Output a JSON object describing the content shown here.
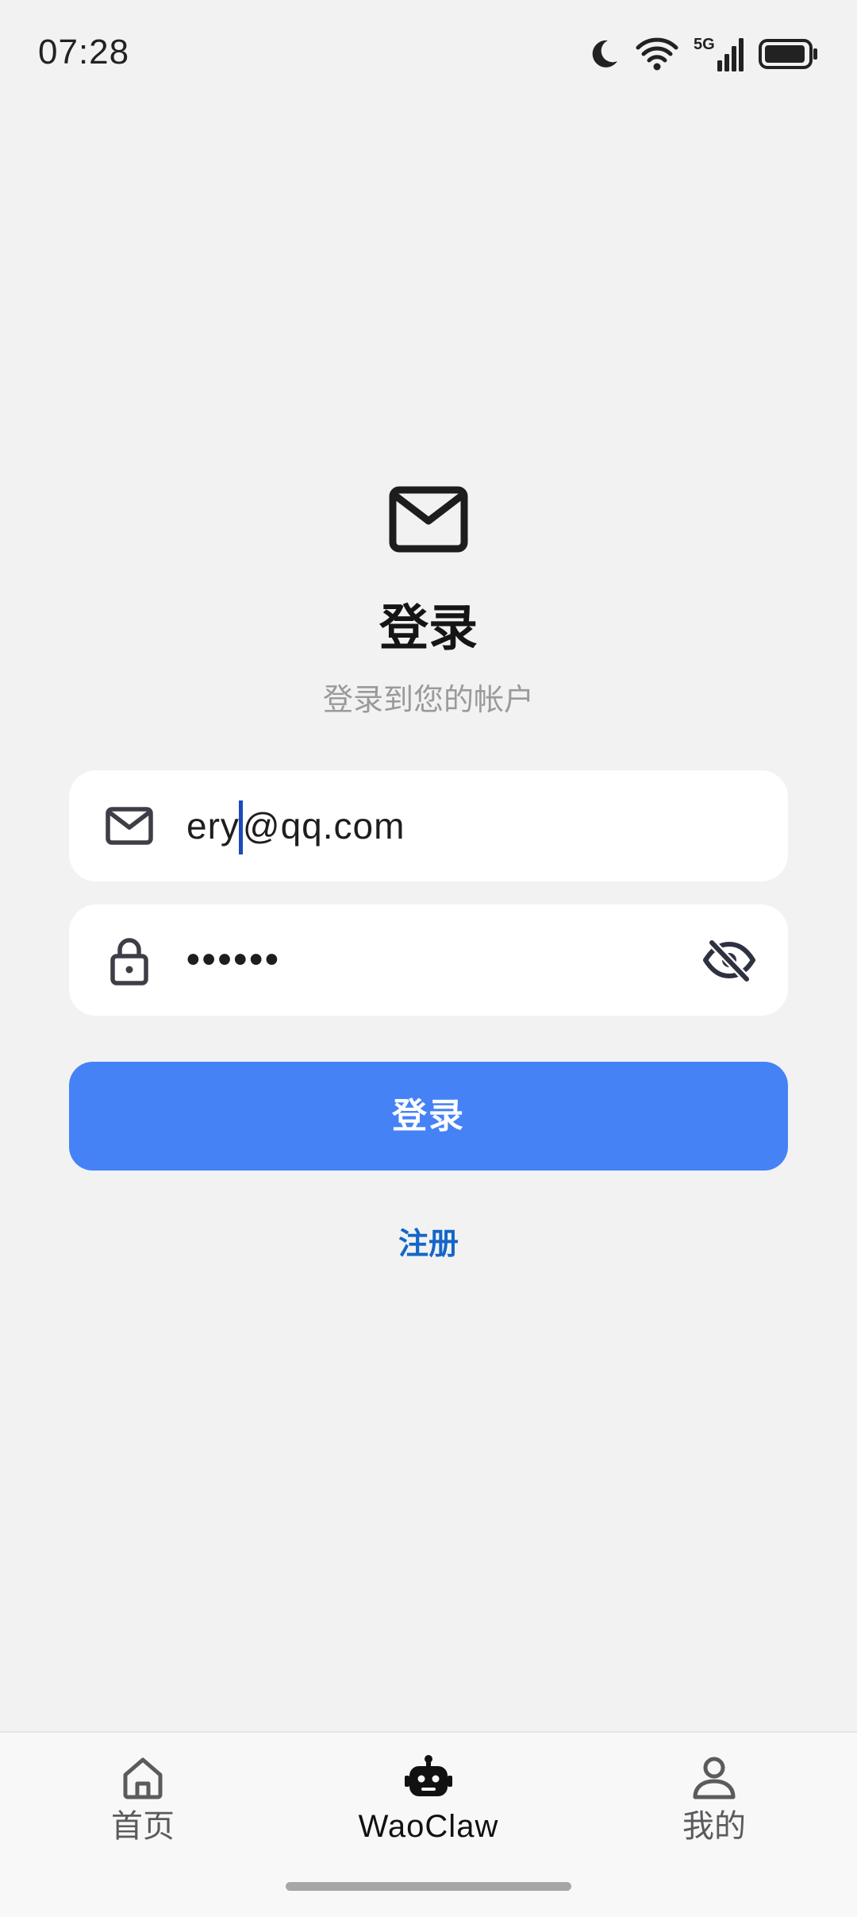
{
  "status_bar": {
    "time": "07:28",
    "network": "5G",
    "icons": [
      "moon-icon",
      "wifi-icon",
      "cellular-5g-icon",
      "battery-icon"
    ]
  },
  "login": {
    "icon": "mail-icon",
    "title": "登录",
    "subtitle": "登录到您的帐户",
    "email": {
      "icon": "mail-icon",
      "value_before_caret": "ery",
      "value_after_caret": "@qq.com"
    },
    "password": {
      "icon": "lock-icon",
      "masked_value": "••••••",
      "toggle_icon": "eye-off-icon"
    },
    "submit_label": "登录",
    "register_label": "注册"
  },
  "bottom_nav": {
    "items": [
      {
        "label": "首页",
        "icon": "home-icon",
        "active": false
      },
      {
        "label": "WaoClaw",
        "icon": "robot-icon",
        "active": true
      },
      {
        "label": "我的",
        "icon": "person-icon",
        "active": false
      }
    ]
  },
  "colors": {
    "background": "#F2F2F3",
    "primary": "#4582F6",
    "link": "#1466C8",
    "caret": "#1C4BB8",
    "subtitle": "#9A9A9A"
  }
}
